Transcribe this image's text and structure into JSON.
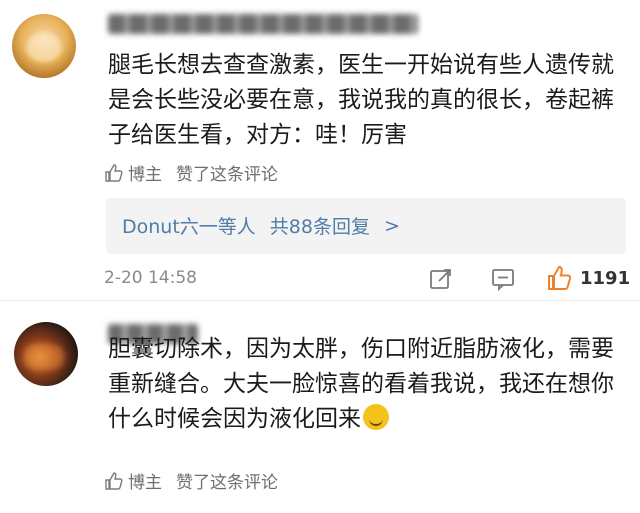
{
  "comments": [
    {
      "body_lines": [
        "腿毛长想去查查激素，医生一开始说有些人遗传就",
        "是会长些没必要在意，我说我的真的很长，卷起裤",
        "子给医生看，对方：哇！厉害"
      ],
      "byline": {
        "author_label": "博主",
        "liked_text": "赞了这条评论"
      },
      "reply_summary": {
        "author": "Donut六一等人",
        "count_text": "共88条回复",
        "chevron": ">"
      },
      "timestamp": "2-20 14:58",
      "like_count": "1191"
    },
    {
      "body_lines": [
        "胆囊切除术，因为太胖，伤口附近脂肪液化，需要",
        "重新缝合。大夫一脸惊喜的看着我说，我还在想你",
        "什么时候会因为液化回来"
      ],
      "byline": {
        "author_label": "博主",
        "liked_text": "赞了这条评论"
      }
    }
  ],
  "icons": {
    "thumb": "thumbs-up-icon",
    "share": "share-edit-icon",
    "comment": "comment-bubble-icon",
    "like": "like-thumb-icon",
    "emoji": "grin-emoji-icon"
  },
  "colors": {
    "link": "#507ca8",
    "like_orange": "#f0822b"
  }
}
